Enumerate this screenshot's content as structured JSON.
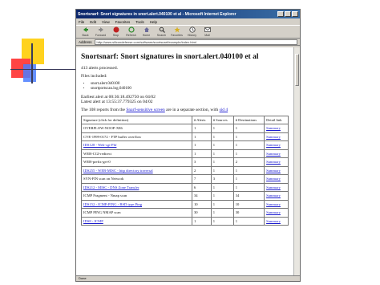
{
  "window": {
    "title": "Snortsnarf: Snort signatures in snort.alert.040100 et al - Microsoft Internet Explorer"
  },
  "menu": [
    "File",
    "Edit",
    "View",
    "Favorites",
    "Tools",
    "Help"
  ],
  "toolbar": [
    {
      "label": "Back",
      "icon": "back-arrow-icon"
    },
    {
      "label": "Forward",
      "icon": "forward-arrow-icon"
    },
    {
      "label": "Stop",
      "icon": "stop-icon"
    },
    {
      "label": "Refresh",
      "icon": "refresh-icon"
    },
    {
      "label": "Home",
      "icon": "home-icon"
    },
    {
      "label": "Search",
      "icon": "search-icon"
    },
    {
      "label": "Favorites",
      "icon": "favorites-icon"
    },
    {
      "label": "History",
      "icon": "history-icon"
    },
    {
      "label": "Mail",
      "icon": "mail-icon"
    }
  ],
  "address": {
    "label": "Address",
    "value": "http://www.silicondefense.com/software/snortsnarf/example/index.html"
  },
  "page": {
    "heading": "Snortsnarf: Snort signatures in snort.alert.040100 et al",
    "alerts_line": "413 alerts processed.",
    "files_label": "Files included:",
    "files": [
      "snort.alert.040100",
      "snortportscan.log.040100"
    ],
    "earliest": "Earliest alert at 00:36:18.492750 on 04/02",
    "latest": "Latest alert at 13:55:37.779325 on 04/02",
    "sources_line": {
      "prefix": "The 108 reports from the",
      "link1": "Snarf-sensitive screen",
      "middle": "are in a separate section, with",
      "link2": "sid 4"
    }
  },
  "table": {
    "headers": [
      "Signature (click for definition)",
      "# Alerts",
      "# Sources",
      "# Destinations",
      "Detail link"
    ],
    "rows": [
      {
        "sig": "OVERFLOW-NOOP-X86",
        "sig_link": false,
        "alerts": "1",
        "sources": "1",
        "dests": "1",
        "detail": "Summary"
      },
      {
        "sig": "CVE-1999-0172 - FTP buffer overflow",
        "sig_link": false,
        "alerts": "1",
        "sources": "1",
        "dests": "1",
        "detail": "Summary"
      },
      {
        "sig": "IDS128 - Web-cgi-Phf",
        "sig_link": true,
        "alerts": "1",
        "sources": "1",
        "dests": "1",
        "detail": "Summary"
      },
      {
        "sig": "WEB-CGI-redirect",
        "sig_link": false,
        "alerts": "1",
        "sources": "1",
        "dests": "1",
        "detail": "Summary"
      },
      {
        "sig": "WEB-prefix-get-0",
        "sig_link": false,
        "alerts": "3",
        "sources": "1",
        "dests": "2",
        "detail": "Summary"
      },
      {
        "sig": "IDS255 - WEB-MISC - http directory traversal",
        "sig_link": true,
        "alerts": "2",
        "sources": "1",
        "dests": "1",
        "detail": "Summary"
      },
      {
        "sig": "SYN-FIN scan on Network",
        "sig_link": false,
        "alerts": "7",
        "sources": "3",
        "dests": "1",
        "detail": "Summary"
      },
      {
        "sig": "IDS212 - MISC - DNS Zone Transfer",
        "sig_link": true,
        "alerts": "6",
        "sources": "1",
        "dests": "1",
        "detail": "Summary"
      },
      {
        "sig": "ICMP Fragment - Nmap scan",
        "sig_link": false,
        "alerts": "34",
        "sources": "1",
        "dests": "34",
        "detail": "Summary"
      },
      {
        "sig": "IDS152 - ICMP-PING - BSD type Ping",
        "sig_link": true,
        "alerts": "10",
        "sources": "1",
        "dests": "10",
        "detail": "Summary"
      },
      {
        "sig": "ICMP PING NMAP scan",
        "sig_link": false,
        "alerts": "30",
        "sources": "1",
        "dests": "30",
        "detail": "Summary"
      },
      {
        "sig": "IDS8 - ICMP",
        "sig_link": true,
        "alerts": "1",
        "sources": "1",
        "dests": "1",
        "detail": "Summary"
      }
    ]
  },
  "status": {
    "text": "Done"
  },
  "colors": {
    "link": "#1a1ad0",
    "titlebar": "#0a246a"
  }
}
